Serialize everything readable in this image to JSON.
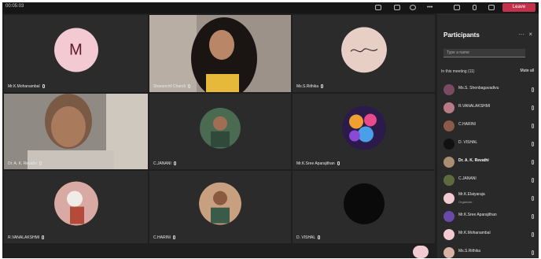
{
  "topbar": {
    "time": "00:05:03",
    "leave_label": "Leave"
  },
  "tiles": [
    {
      "name": "Mr.K.Mohanambal",
      "avatar_letter": "M"
    },
    {
      "name": "Sharanchil Chandi"
    },
    {
      "name": "Ms.S.Rithika"
    },
    {
      "name": "Dr. A. K. Revathi"
    },
    {
      "name": "C.JANANI"
    },
    {
      "name": "Mr.K.Sree Aparajithan"
    },
    {
      "name": "R.VANALAKSHMI"
    },
    {
      "name": "C.HARINI"
    },
    {
      "name": "D. VISHAL"
    }
  ],
  "panel": {
    "title": "Participants",
    "search_placeholder": "Type a name",
    "section_label": "In this meeting (11)",
    "mute_all_label": "Mute all",
    "participants": [
      {
        "name": "Ms.S. Shenbagavadivu",
        "color": "#7a4a63"
      },
      {
        "name": "R.VANALAKSHMI",
        "color": "#b77a86"
      },
      {
        "name": "C.HARINI",
        "color": "#8b5a4a"
      },
      {
        "name": "D. VISHAL",
        "color": "#111111"
      },
      {
        "name": "Dr. A. K. Revathi",
        "color": "#a98e74"
      },
      {
        "name": "C.JANANI",
        "color": "#5e6a3e"
      },
      {
        "name": "Mr.K.Elaiyaraja",
        "role": "Organizer",
        "color": "#f3c9d2"
      },
      {
        "name": "Mr.K.Sree Aparajithan",
        "color": "#6a4aa8"
      },
      {
        "name": "Mr.K.Mohanambal",
        "color": "#f3c9d2"
      },
      {
        "name": "Ms.S.Rithika",
        "color": "#d9b3a6"
      }
    ]
  },
  "colors": {
    "leave": "#c4314b",
    "avatar_pink": "#f3c9d2",
    "background": "#1f1f1f"
  }
}
